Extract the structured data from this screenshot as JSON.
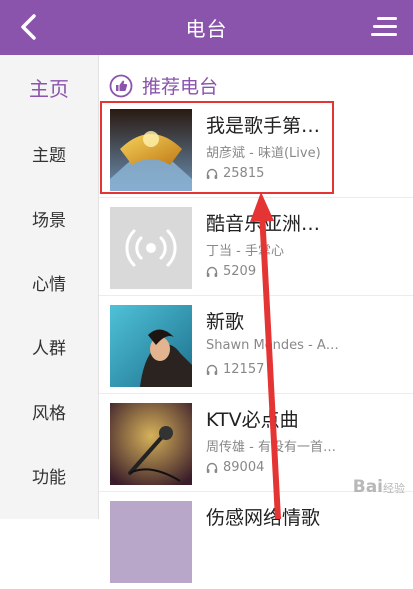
{
  "header": {
    "title": "电台",
    "back_icon": "chevron-left-icon",
    "menu_icon": "hamburger-icon"
  },
  "sidebar": {
    "items": [
      {
        "label": "主页",
        "active": true
      },
      {
        "label": "主题"
      },
      {
        "label": "场景"
      },
      {
        "label": "心情"
      },
      {
        "label": "人群"
      },
      {
        "label": "风格"
      },
      {
        "label": "功能"
      }
    ]
  },
  "section": {
    "title": "推荐电台",
    "icon": "thumbs-up-icon"
  },
  "stations": [
    {
      "title": "我是歌手第…",
      "subtitle": "胡彦斌 - 味道(Live)",
      "plays": "25815",
      "thumb": "stage-cover"
    },
    {
      "title": "酷音乐亚洲…",
      "subtitle": "丁当 - 手掌心",
      "plays": "5209",
      "thumb": "radio-placeholder"
    },
    {
      "title": "新歌",
      "subtitle": "Shawn Mendes - A…",
      "plays": "12157",
      "thumb": "singer-cover"
    },
    {
      "title": "KTV必点曲",
      "subtitle": "周传雄 - 有没有一首…",
      "plays": "89004",
      "thumb": "microphone-cover"
    },
    {
      "title": "伤感网络情歌",
      "subtitle": "",
      "plays": "",
      "thumb": "partial-cover"
    }
  ],
  "watermark": {
    "text": "Bai",
    "suffix": "经验"
  },
  "colors": {
    "brand": "#8a53ac",
    "highlight": "#e53434"
  }
}
